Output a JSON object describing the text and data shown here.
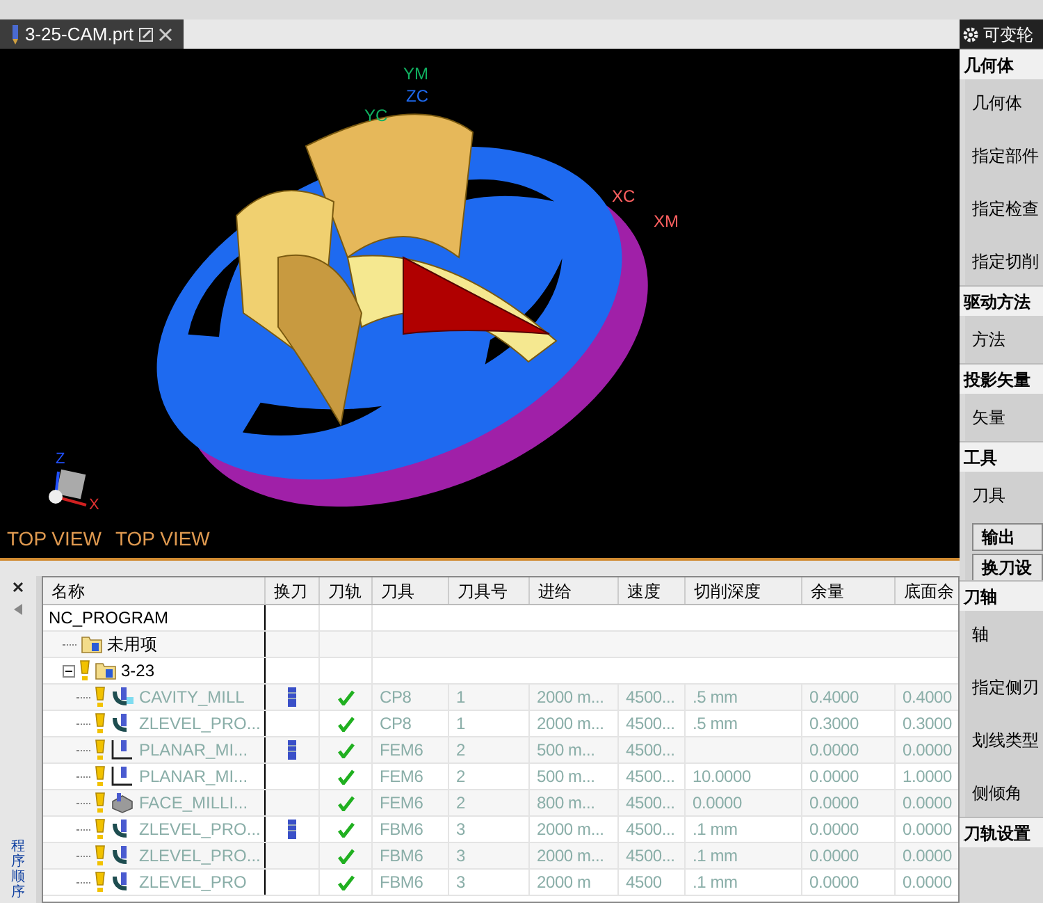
{
  "file_tab": {
    "title": "3-25-CAM.prt"
  },
  "dialog_title": "可变轮",
  "viewport": {
    "axis_labels": [
      {
        "text": "YM",
        "kind": "ym"
      },
      {
        "text": "ZC",
        "kind": "zc"
      },
      {
        "text": "YC",
        "kind": "yc"
      },
      {
        "text": "XC",
        "kind": "xc"
      },
      {
        "text": "XM",
        "kind": "xm"
      }
    ],
    "triad_labels": [
      {
        "text": "Z",
        "kind": "z"
      },
      {
        "text": "X",
        "kind": "x"
      }
    ],
    "view_labels": [
      "TOP VIEW",
      "TOP VIEW"
    ]
  },
  "navigator": {
    "side_tab": "程序顺序",
    "columns": [
      "名称",
      "换刀",
      "刀轨",
      "刀具",
      "刀具号",
      "进给",
      "速度",
      "切削深度",
      "余量",
      "底面余"
    ],
    "tree": [
      {
        "name": "NC_PROGRAM",
        "kind": "program",
        "children": [
          {
            "name": "未用项",
            "kind": "group"
          },
          {
            "name": "3-23",
            "kind": "group",
            "expanded": true,
            "children": [
              {
                "name": "CAVITY_MILL",
                "kind": "cavity",
                "tool_change": true,
                "path_ok": true,
                "cells": [
                  "CP8",
                  "1",
                  "2000 m...",
                  "4500...",
                  ".5 mm",
                  "0.4000",
                  "0.4000"
                ]
              },
              {
                "name": "ZLEVEL_PRO...",
                "kind": "zlevel",
                "tool_change": false,
                "path_ok": true,
                "cells": [
                  "CP8",
                  "1",
                  "2000 m...",
                  "4500...",
                  ".5 mm",
                  "0.3000",
                  "0.3000"
                ]
              },
              {
                "name": "PLANAR_MI...",
                "kind": "planar",
                "tool_change": true,
                "path_ok": true,
                "cells": [
                  "FEM6",
                  "2",
                  "500 m...",
                  "4500...",
                  "",
                  "0.0000",
                  "0.0000"
                ]
              },
              {
                "name": "PLANAR_MI...",
                "kind": "planar",
                "tool_change": false,
                "path_ok": true,
                "cells": [
                  "FEM6",
                  "2",
                  "500 m...",
                  "4500...",
                  "10.0000",
                  "0.0000",
                  "1.0000"
                ]
              },
              {
                "name": "FACE_MILLI...",
                "kind": "face",
                "tool_change": false,
                "path_ok": true,
                "cells": [
                  "FEM6",
                  "2",
                  "800 m...",
                  "4500...",
                  "0.0000",
                  "0.0000",
                  "0.0000"
                ]
              },
              {
                "name": "ZLEVEL_PRO...",
                "kind": "zlevel",
                "tool_change": true,
                "path_ok": true,
                "cells": [
                  "FBM6",
                  "3",
                  "2000 m...",
                  "4500...",
                  ".1 mm",
                  "0.0000",
                  "0.0000"
                ]
              },
              {
                "name": "ZLEVEL_PRO...",
                "kind": "zlevel",
                "tool_change": false,
                "path_ok": true,
                "cells": [
                  "FBM6",
                  "3",
                  "2000 m...",
                  "4500...",
                  ".1 mm",
                  "0.0000",
                  "0.0000"
                ]
              },
              {
                "name": "ZLEVEL_PRO",
                "kind": "zlevel",
                "tool_change": false,
                "path_ok": true,
                "cells": [
                  "FBM6",
                  "3",
                  "2000 m",
                  "4500",
                  ".1 mm",
                  "0.0000",
                  "0.0000"
                ]
              }
            ]
          }
        ]
      }
    ]
  },
  "panel": {
    "sections": [
      {
        "title": "几何体",
        "items": [
          {
            "kind": "label",
            "text": "几何体"
          },
          {
            "kind": "label",
            "text": "指定部件"
          },
          {
            "kind": "label",
            "text": "指定检查"
          },
          {
            "kind": "label",
            "text": "指定切削"
          }
        ]
      },
      {
        "title": "驱动方法",
        "items": [
          {
            "kind": "label",
            "text": "方法"
          }
        ]
      },
      {
        "title": "投影矢量",
        "items": [
          {
            "kind": "label",
            "text": "矢量"
          }
        ]
      },
      {
        "title": "工具",
        "items": [
          {
            "kind": "label",
            "text": "刀具"
          },
          {
            "kind": "button",
            "text": "输出"
          },
          {
            "kind": "button",
            "text": "换刀设"
          }
        ]
      },
      {
        "title": "刀轴",
        "items": [
          {
            "kind": "label",
            "text": "轴"
          },
          {
            "kind": "label",
            "text": "指定侧刃"
          },
          {
            "kind": "label",
            "text": "划线类型"
          },
          {
            "kind": "label",
            "text": "侧倾角"
          }
        ]
      },
      {
        "title": "刀轨设置"
      }
    ]
  }
}
